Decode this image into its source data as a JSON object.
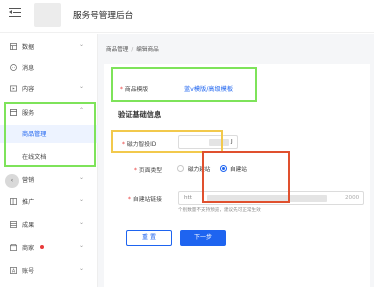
{
  "header": {
    "app_title": "服务号管理后台",
    "menu_icon": "menu-fold-icon"
  },
  "sidebar": {
    "items": [
      {
        "label": "数据",
        "icon": "data-grid-icon",
        "has_arrow": true
      },
      {
        "label": "消息",
        "icon": "message-icon",
        "has_arrow": false
      },
      {
        "label": "内容",
        "icon": "content-play-icon",
        "has_arrow": true
      },
      {
        "label": "服务",
        "icon": "service-icon",
        "has_arrow": true,
        "expanded": true
      },
      {
        "label": "商品管理",
        "sub": true,
        "active": true
      },
      {
        "label": "在线文档",
        "sub": true
      },
      {
        "label": "营销",
        "icon": "marketing-icon",
        "has_arrow": true
      },
      {
        "label": "推广",
        "icon": "promotion-icon",
        "has_arrow": true
      },
      {
        "label": "成果",
        "icon": "results-icon",
        "has_arrow": true
      },
      {
        "label": "商家",
        "icon": "store-icon",
        "has_arrow": true,
        "badge_dot": true
      },
      {
        "label": "账号",
        "icon": "account-icon",
        "has_arrow": true
      }
    ],
    "arrow_down": "⌄",
    "arrow_up": "⌃",
    "collapse_arrow": "‹"
  },
  "breadcrumb": {
    "root": "商品管理",
    "separator": "/",
    "current": "编辑商品"
  },
  "form": {
    "template_label": "商品模版",
    "template_value": "蓝v模版/高级模板",
    "section_title": "验证基础信息",
    "magnet_id_label": "磁力智投ID",
    "magnet_id_suffix": "J",
    "page_type_label": "页面类型",
    "page_type_options": [
      {
        "label": "磁力建站",
        "checked": false
      },
      {
        "label": "自建站",
        "checked": true
      }
    ],
    "site_link_label": "自建站链接",
    "site_link_prefix": "htt",
    "site_link_counter": "2000",
    "site_link_hint": "个别数量不支持预览，建议先可正常生效"
  },
  "buttons": {
    "reset": "重 置",
    "next": "下一步"
  },
  "colors": {
    "primary": "#1e64f0",
    "highlight_green": "#7ee35a",
    "highlight_yellow": "#f2c94c",
    "highlight_red": "#e0502e",
    "required": "#e83a3a"
  }
}
